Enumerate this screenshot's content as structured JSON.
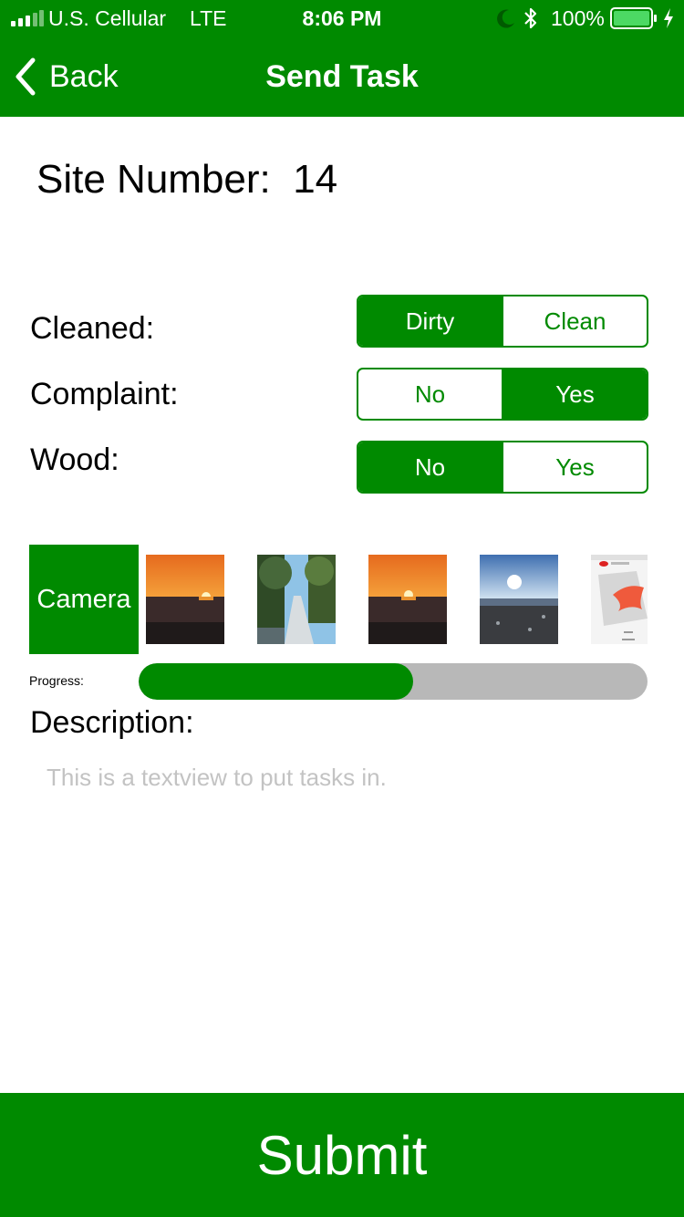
{
  "status_bar": {
    "carrier": "U.S. Cellular",
    "network": "LTE",
    "time": "8:06 PM",
    "battery_percent": "100%",
    "signal_icon": "signal-bars-icon",
    "moon_icon": "do-not-disturb-moon-icon",
    "bluetooth_icon": "bluetooth-icon",
    "battery_icon": "battery-full-icon",
    "charging_icon": "charging-bolt-icon"
  },
  "nav": {
    "back_label": "Back",
    "back_icon": "chevron-left-icon",
    "title": "Send Task"
  },
  "site": {
    "text": "Site Number:  14"
  },
  "fields": {
    "cleaned": {
      "label": "Cleaned:",
      "options": [
        "Dirty",
        "Clean"
      ],
      "selected": "Dirty"
    },
    "complaint": {
      "label": "Complaint:",
      "options": [
        "No",
        "Yes"
      ],
      "selected": "Yes"
    },
    "wood": {
      "label": "Wood:",
      "options": [
        "No",
        "Yes"
      ],
      "selected": "No"
    }
  },
  "photos": {
    "camera_label": "Camera",
    "thumbnails": [
      "sunset-over-water-photo",
      "sandy-path-through-trees-photo",
      "sunset-over-water-photo",
      "sun-over-beach-photo",
      "swift-logo-screenshot-photo"
    ]
  },
  "progress": {
    "label": "Progress:",
    "value": 0.54
  },
  "description": {
    "label": "Description:",
    "placeholder": "This is a textview to put tasks in."
  },
  "submit": {
    "label": "Submit"
  },
  "colors": {
    "accent": "#008a00",
    "progress_track": "#b8b8b8",
    "placeholder_text": "#c3c3c3"
  }
}
